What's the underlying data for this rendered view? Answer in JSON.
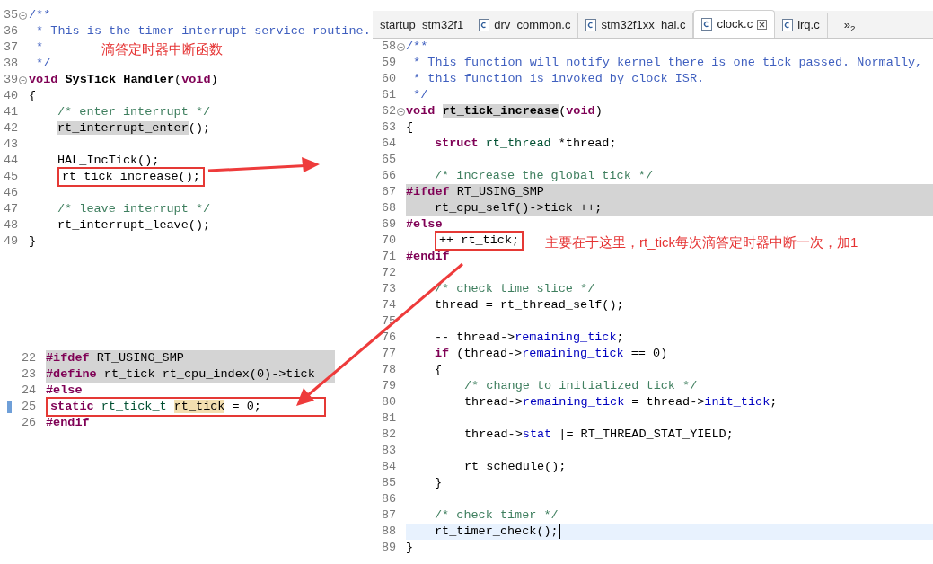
{
  "top_left_editor": {
    "lines": [
      {
        "n": "35",
        "kind": "top",
        "fold": true,
        "tokens": [
          {
            "text": "/**",
            "kind": "doc"
          }
        ]
      },
      {
        "n": "36",
        "kind": "top",
        "tokens": [
          {
            "text": " * This is the timer interrupt service routine.",
            "kind": "doc"
          }
        ]
      },
      {
        "n": "37",
        "kind": "top",
        "tokens": [
          {
            "text": " *",
            "kind": "doc"
          }
        ]
      },
      {
        "n": "38",
        "kind": "top",
        "tokens": [
          {
            "text": " */",
            "kind": "doc"
          }
        ]
      },
      {
        "n": "39",
        "kind": "top",
        "fold": true,
        "tokens": [
          {
            "text": "void ",
            "kind": "kw"
          },
          {
            "text": "SysTick_Handler",
            "kind": "def"
          },
          {
            "text": "(",
            "kind": "plain"
          },
          {
            "text": "void",
            "kind": "kw"
          },
          {
            "text": ")",
            "kind": "plain"
          }
        ]
      },
      {
        "n": "40",
        "kind": "top",
        "tokens": [
          {
            "text": "{",
            "kind": "plain"
          }
        ]
      },
      {
        "n": "41",
        "kind": "block",
        "tokens": [
          {
            "text": "/* enter interrupt */",
            "kind": "comment"
          }
        ]
      },
      {
        "n": "42",
        "kind": "block",
        "tokens": [
          {
            "text": "rt_interrupt_enter",
            "kind": "hl"
          },
          {
            "text": "();",
            "kind": "plain"
          }
        ]
      },
      {
        "n": "43",
        "kind": "top"
      },
      {
        "n": "44",
        "kind": "block",
        "tokens": [
          {
            "text": "HAL_IncTick();",
            "kind": "plain"
          }
        ]
      },
      {
        "n": "45",
        "kind": "block",
        "boxed": true,
        "tokens": [
          {
            "text": "rt_tick_increase();",
            "kind": "plain"
          }
        ]
      },
      {
        "n": "46",
        "kind": "top"
      },
      {
        "n": "47",
        "kind": "block",
        "tokens": [
          {
            "text": "/* leave interrupt */",
            "kind": "comment"
          }
        ]
      },
      {
        "n": "48",
        "kind": "block",
        "tokens": [
          {
            "text": "rt_interrupt_leave();",
            "kind": "plain"
          }
        ]
      },
      {
        "n": "49",
        "kind": "top",
        "tokens": [
          {
            "text": "}",
            "kind": "plain"
          }
        ]
      }
    ]
  },
  "right_editor": {
    "tabs": [
      {
        "label": "startup_stm32f1",
        "selected": false,
        "file_icon": false,
        "closable": false
      },
      {
        "label": "drv_common.c",
        "selected": false,
        "file_icon": true,
        "closable": false
      },
      {
        "label": "stm32f1xx_hal.c",
        "selected": false,
        "file_icon": true,
        "closable": false
      },
      {
        "label": "clock.c",
        "selected": true,
        "file_icon": true,
        "closable": true
      },
      {
        "label": "irq.c",
        "selected": false,
        "file_icon": true,
        "closable": false
      }
    ],
    "overflow": "»$_{2}$",
    "lines": [
      {
        "n": "58",
        "kind": "top",
        "fold": true,
        "tokens": [
          {
            "text": "/**",
            "kind": "doc"
          }
        ]
      },
      {
        "n": "59",
        "kind": "top",
        "tokens": [
          {
            "text": " * This function will notify kernel there is one tick passed. Normally,",
            "kind": "doc"
          }
        ]
      },
      {
        "n": "60",
        "kind": "top",
        "tokens": [
          {
            "text": " * this function is invoked by clock ISR.",
            "kind": "doc"
          }
        ]
      },
      {
        "n": "61",
        "kind": "top",
        "tokens": [
          {
            "text": " */",
            "kind": "doc"
          }
        ]
      },
      {
        "n": "62",
        "kind": "top",
        "fold": true,
        "tokens": [
          {
            "text": "void ",
            "kind": "kw"
          },
          {
            "text": "rt_tick_increase",
            "kind": "defhl"
          },
          {
            "text": "(",
            "kind": "plain"
          },
          {
            "text": "void",
            "kind": "kw"
          },
          {
            "text": ")",
            "kind": "plain"
          }
        ]
      },
      {
        "n": "63",
        "kind": "top",
        "tokens": [
          {
            "text": "{",
            "kind": "plain"
          }
        ]
      },
      {
        "n": "64",
        "kind": "block",
        "tokens": [
          {
            "text": "struct ",
            "kind": "kw"
          },
          {
            "text": "rt_thread",
            "kind": "type"
          },
          {
            "text": " *thread;",
            "kind": "plain"
          }
        ]
      },
      {
        "n": "65",
        "kind": "top"
      },
      {
        "n": "66",
        "kind": "block",
        "tokens": [
          {
            "text": "/* increase the global tick */",
            "kind": "comment"
          }
        ]
      },
      {
        "n": "67",
        "kind": "top",
        "highlighted": true,
        "tokens": [
          {
            "text": "#ifdef",
            "kind": "kw"
          },
          {
            "text": " RT_USING_SMP",
            "kind": "plain"
          }
        ]
      },
      {
        "n": "68",
        "kind": "block",
        "highlighted": true,
        "tokens": [
          {
            "text": "rt_cpu_self()->tick ++;",
            "kind": "plain"
          }
        ]
      },
      {
        "n": "69",
        "kind": "top",
        "tokens": [
          {
            "text": "#else",
            "kind": "kw"
          }
        ]
      },
      {
        "n": "70",
        "kind": "block",
        "boxed": true,
        "tokens": [
          {
            "text": "++ rt_tick;",
            "kind": "plain"
          }
        ]
      },
      {
        "n": "71",
        "kind": "top",
        "tokens": [
          {
            "text": "#endif",
            "kind": "kw"
          }
        ]
      },
      {
        "n": "72",
        "kind": "top"
      },
      {
        "n": "73",
        "kind": "block",
        "tokens": [
          {
            "text": "/* check time slice */",
            "kind": "comment"
          }
        ]
      },
      {
        "n": "74",
        "kind": "block",
        "tokens": [
          {
            "text": "thread = rt_thread_self();",
            "kind": "plain"
          }
        ]
      },
      {
        "n": "75",
        "kind": "top"
      },
      {
        "n": "76",
        "kind": "block",
        "tokens": [
          {
            "text": "-- thread->",
            "kind": "plain"
          },
          {
            "text": "remaining_tick",
            "kind": "field"
          },
          {
            "text": ";",
            "kind": "plain"
          }
        ]
      },
      {
        "n": "77",
        "kind": "block",
        "tokens": [
          {
            "text": "if",
            "kind": "kw"
          },
          {
            "text": " (thread->",
            "kind": "plain"
          },
          {
            "text": "remaining_tick",
            "kind": "field"
          },
          {
            "text": " == 0)",
            "kind": "plain"
          }
        ]
      },
      {
        "n": "78",
        "kind": "block",
        "tokens": [
          {
            "text": "{",
            "kind": "plain"
          }
        ]
      },
      {
        "n": "79",
        "kind": "inner",
        "tokens": [
          {
            "text": "/* change to initialized tick */",
            "kind": "comment"
          }
        ]
      },
      {
        "n": "80",
        "kind": "inner",
        "tokens": [
          {
            "text": "thread->",
            "kind": "plain"
          },
          {
            "text": "remaining_tick",
            "kind": "field"
          },
          {
            "text": " = thread->",
            "kind": "plain"
          },
          {
            "text": "init_tick",
            "kind": "field"
          },
          {
            "text": ";",
            "kind": "plain"
          }
        ]
      },
      {
        "n": "81",
        "kind": "top"
      },
      {
        "n": "82",
        "kind": "inner",
        "tokens": [
          {
            "text": "thread->",
            "kind": "plain"
          },
          {
            "text": "stat",
            "kind": "field"
          },
          {
            "text": " |= RT_THREAD_STAT_YIELD;",
            "kind": "plain"
          }
        ]
      },
      {
        "n": "83",
        "kind": "top"
      },
      {
        "n": "84",
        "kind": "inner",
        "tokens": [
          {
            "text": "rt_schedule();",
            "kind": "plain"
          }
        ]
      },
      {
        "n": "85",
        "kind": "block",
        "tokens": [
          {
            "text": "}",
            "kind": "plain"
          }
        ]
      },
      {
        "n": "86",
        "kind": "top"
      },
      {
        "n": "87",
        "kind": "block",
        "tokens": [
          {
            "text": "/* check timer */",
            "kind": "comment"
          }
        ]
      },
      {
        "n": "88",
        "kind": "block",
        "current": true,
        "tokens": [
          {
            "text": "rt_timer_check();",
            "kind": "plain"
          }
        ]
      },
      {
        "n": "89",
        "kind": "top",
        "tokens": [
          {
            "text": "}",
            "kind": "plain"
          }
        ]
      }
    ]
  },
  "bottom_left_editor": {
    "lines": [
      {
        "n": "22",
        "highlighted": true,
        "tokens": [
          {
            "text": "#ifdef",
            "kind": "kw"
          },
          {
            "text": " RT_USING_SMP",
            "kind": "plain"
          }
        ]
      },
      {
        "n": "23",
        "highlighted": true,
        "tokens": [
          {
            "text": "#define",
            "kind": "kw"
          },
          {
            "text": " rt_tick rt_cpu_index(0)->tick",
            "kind": "plain"
          }
        ]
      },
      {
        "n": "24",
        "tokens": [
          {
            "text": "#else",
            "kind": "kw"
          }
        ]
      },
      {
        "n": "25",
        "marked": true,
        "boxed": true,
        "tokens": [
          {
            "text": "static ",
            "kind": "kw"
          },
          {
            "text": "rt_tick_t ",
            "kind": "type"
          },
          {
            "text": "rt_tick",
            "kind": "occ"
          },
          {
            "text": " = 0;",
            "kind": "plain"
          }
        ]
      },
      {
        "n": "26",
        "tokens": [
          {
            "text": "#endif",
            "kind": "kw"
          }
        ]
      }
    ]
  },
  "annotations": [
    {
      "text": "滴答定时器中断函数"
    },
    {
      "text": "主要在于这里，rt_tick每次滴答定时器中断一次，加1"
    }
  ]
}
